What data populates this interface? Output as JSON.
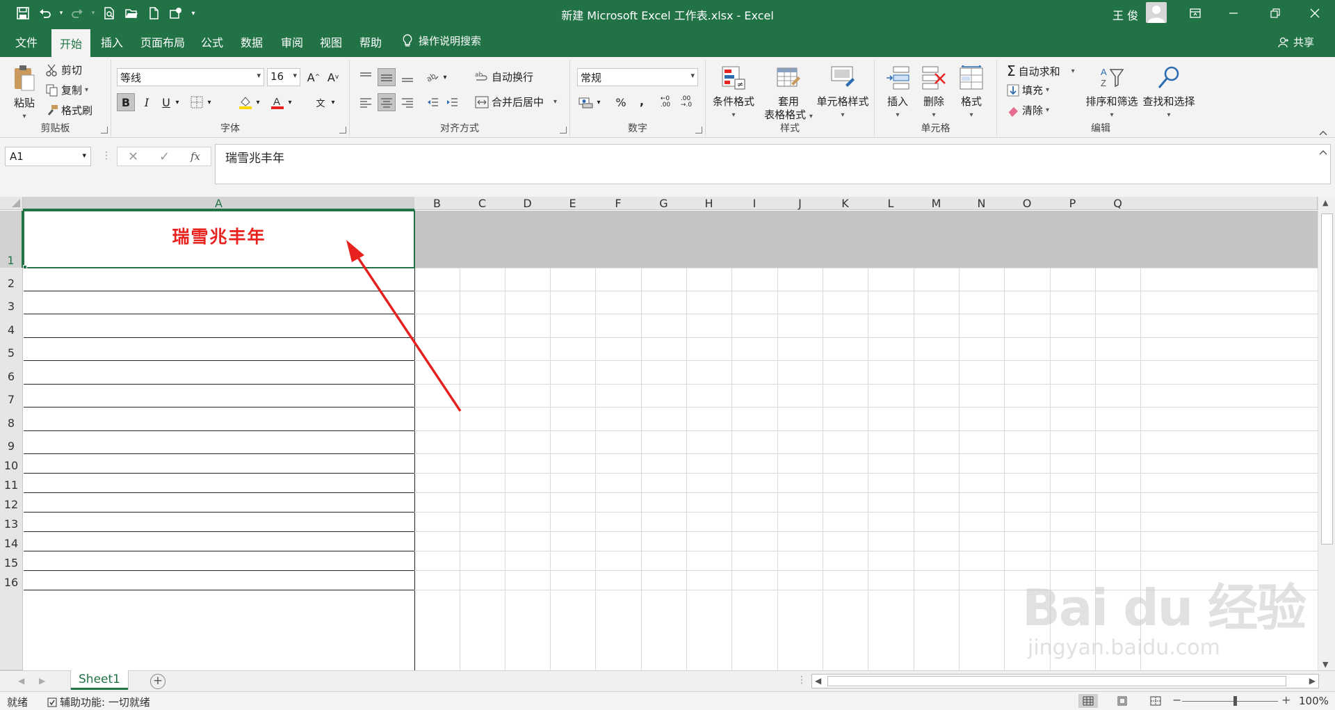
{
  "window": {
    "title": "新建 Microsoft Excel 工作表.xlsx  -  Excel",
    "user": "王 俊"
  },
  "tabs": [
    "文件",
    "开始",
    "插入",
    "页面布局",
    "公式",
    "数据",
    "审阅",
    "视图",
    "帮助"
  ],
  "active_tab": "开始",
  "tell_me": "操作说明搜索",
  "share": "共享",
  "ribbon": {
    "clipboard": {
      "label": "剪贴板",
      "paste": "粘贴",
      "cut": "剪切",
      "copy": "复制",
      "format_painter": "格式刷"
    },
    "font": {
      "label": "字体",
      "font_name": "等线",
      "font_size": "16",
      "bold": "B",
      "italic": "I",
      "underline": "U",
      "wen": "文"
    },
    "alignment": {
      "label": "对齐方式",
      "wrap_text": "自动换行",
      "merge_center": "合并后居中"
    },
    "number": {
      "label": "数字",
      "format": "常规",
      "percent": "%",
      "comma": ","
    },
    "styles": {
      "label": "样式",
      "conditional": "条件格式",
      "table_line1": "套用",
      "table_line2": "表格格式",
      "cell_styles": "单元格样式"
    },
    "cells": {
      "label": "单元格",
      "insert": "插入",
      "delete": "删除",
      "format": "格式"
    },
    "editing": {
      "label": "编辑",
      "autosum": "自动求和",
      "fill": "填充",
      "clear": "清除",
      "sort_filter": "排序和筛选",
      "find_select": "查找和选择"
    }
  },
  "formula_bar": {
    "name_box": "A1",
    "fx": "fx",
    "content": "瑞雪兆丰年"
  },
  "columns": [
    "A",
    "B",
    "C",
    "D",
    "E",
    "F",
    "G",
    "H",
    "I",
    "J",
    "K",
    "L",
    "M",
    "N",
    "O",
    "P",
    "Q"
  ],
  "rows": [
    "1",
    "2",
    "3",
    "4",
    "5",
    "6",
    "7",
    "8",
    "9",
    "10",
    "11",
    "12",
    "13",
    "14",
    "15",
    "16"
  ],
  "selected_cell": {
    "ref": "A1",
    "value": "瑞雪兆丰年",
    "color": "#e8231f"
  },
  "sheets": [
    "Sheet1"
  ],
  "status": {
    "ready": "就绪",
    "accessibility": "辅助功能: 一切就绪",
    "zoom": "100%"
  },
  "watermark": {
    "brand": "Bai du 经验",
    "url": "jingyan.baidu.com"
  },
  "colors": {
    "excel_green": "#217346",
    "accent_red": "#e8231f"
  }
}
